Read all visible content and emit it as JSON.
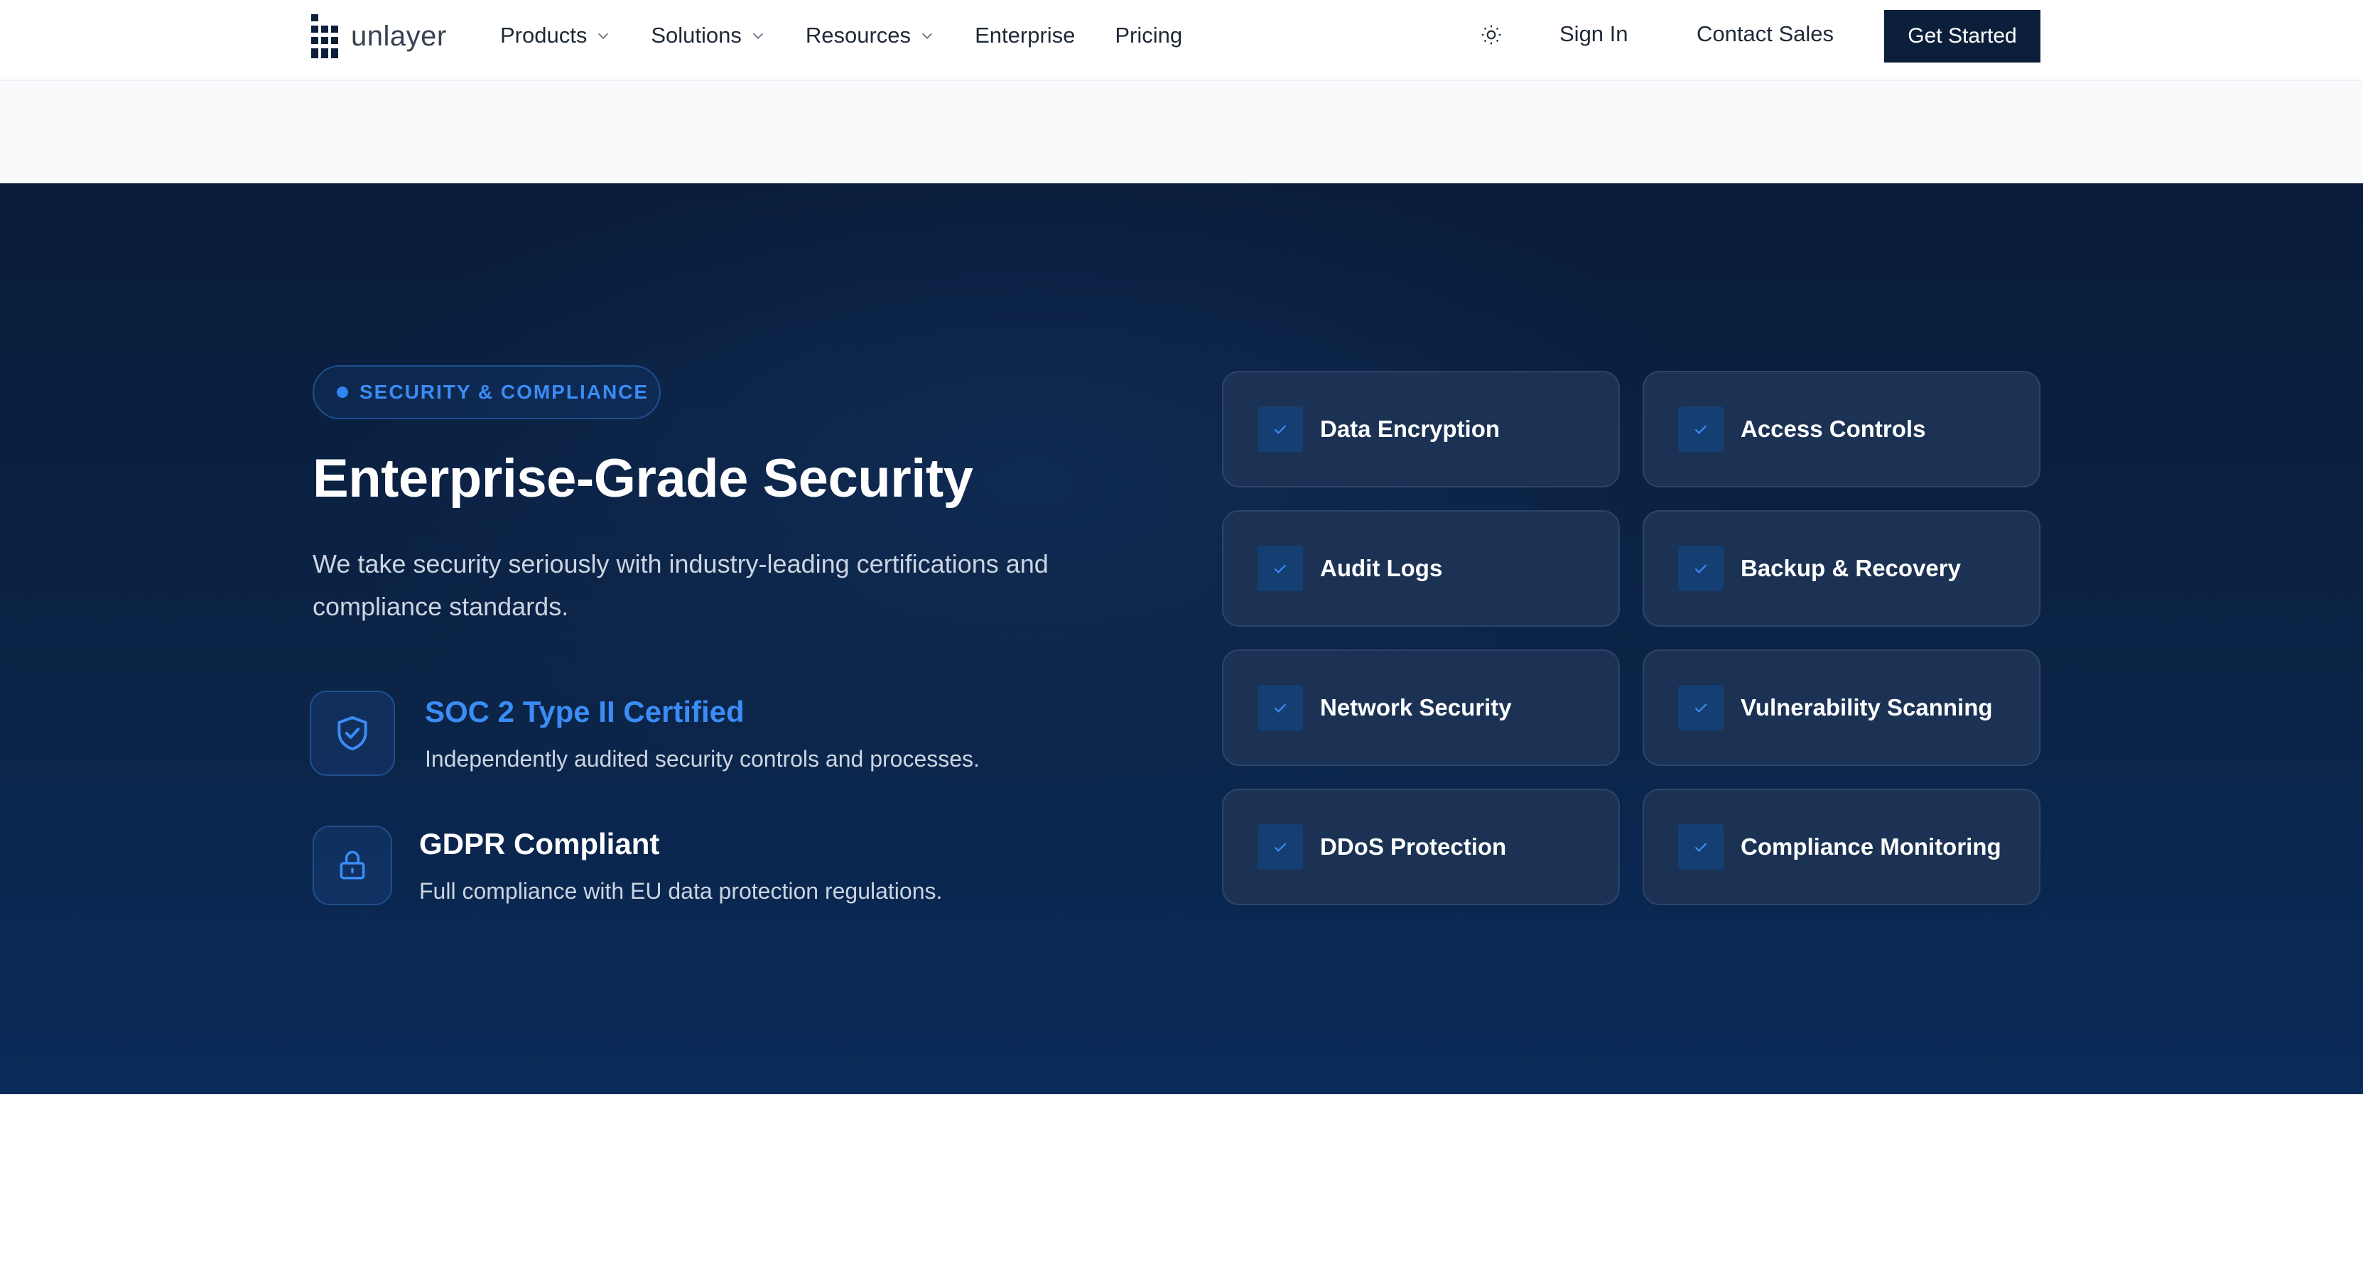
{
  "nav": {
    "logo_text": "unlayer",
    "links": [
      {
        "label": "Products",
        "has_dropdown": true
      },
      {
        "label": "Solutions",
        "has_dropdown": true
      },
      {
        "label": "Resources",
        "has_dropdown": true
      },
      {
        "label": "Enterprise",
        "has_dropdown": false
      },
      {
        "label": "Pricing",
        "has_dropdown": false
      }
    ],
    "theme_icon": "sun-icon",
    "sign_in": "Sign In",
    "contact_sales": "Contact Sales",
    "get_started": "Get Started"
  },
  "security": {
    "badge": "SECURITY & COMPLIANCE",
    "headline": "Enterprise-Grade Security",
    "subtext": "We take security seriously with industry-leading certifications and compliance standards.",
    "features": [
      {
        "title": "SOC 2 Type II Certified",
        "description": "Independently audited security controls and processes.",
        "icon": "shield-check-icon",
        "title_color": "#3b8cf5"
      },
      {
        "title": "GDPR Compliant",
        "description": "Full compliance with EU data protection regulations.",
        "icon": "lock-icon",
        "title_color": "#ffffff"
      }
    ],
    "grid": [
      "Data Encryption",
      "Access Controls",
      "Audit Logs",
      "Backup & Recovery",
      "Network Security",
      "Vulnerability Scanning",
      "DDoS Protection",
      "Compliance Monitoring"
    ]
  },
  "colors": {
    "brand_dark": "#0b1f3a",
    "accent_blue": "#3b8cf5",
    "card_bg": "#1b3254"
  }
}
